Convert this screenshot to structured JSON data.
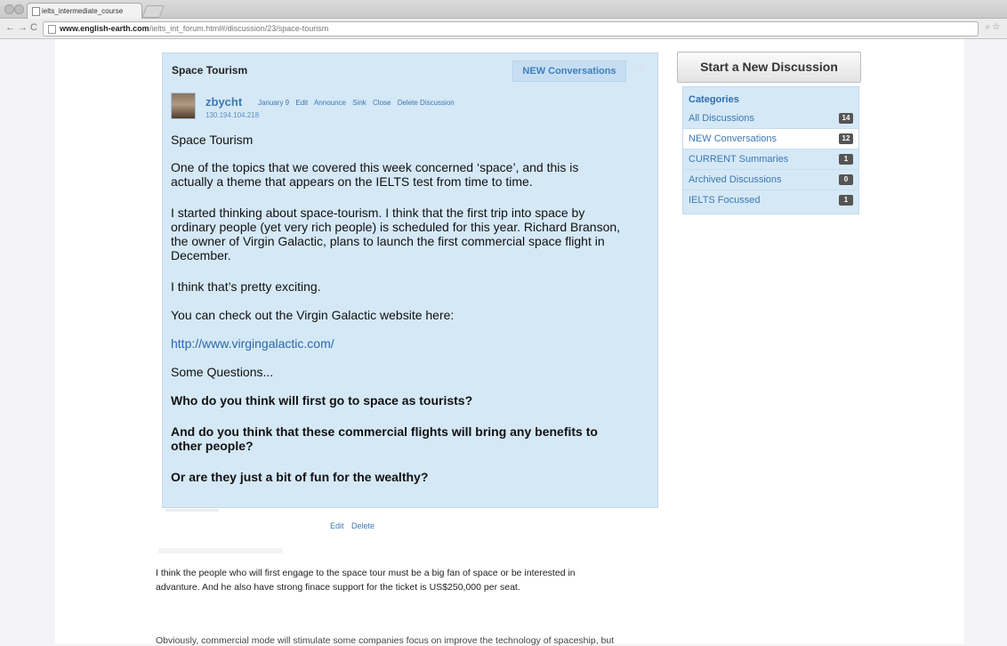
{
  "browser": {
    "tab_title": "ielts_intermediate_course ×",
    "url_domain": "www.english-earth.com",
    "url_path": "/ielts_int_forum.html#/discussion/23/space-tourism"
  },
  "post": {
    "title": "Space Tourism",
    "new_conversations_button": "NEW Conversations",
    "author": "zbycht",
    "date": "January 9",
    "actions": [
      "Edit",
      "Announce",
      "Sink",
      "Close",
      "Delete Discussion"
    ],
    "ip": "130.194.104.218",
    "body": {
      "heading": "Space Tourism",
      "para1_line1": "One of the topics that we covered this week concerned ‘space’, and this is",
      "para1_line2": "actually a theme that appears on the IELTS test from time to time.",
      "para2_line1": "I started thinking about space-tourism. I think that the first trip into space by",
      "para2_line2": "ordinary people (yet very rich people) is scheduled for this year. Richard Branson,",
      "para2_line3": "the owner of Virgin Galactic, plans to launch the first commercial space flight in",
      "para2_line4": "December.",
      "para3": "I think that’s pretty exciting.",
      "para4": "You can check out the Virgin Galactic website here:",
      "link": "http://www.virgingalactic.com/",
      "questions_intro": "Some Questions...",
      "q1": "Who do you think will first go to space as tourists?",
      "q2_line1": "And do you think that these commercial flights will bring any benefits to",
      "q2_line2": "other people?",
      "q3": "Or are they just a bit of fun for the wealthy?"
    },
    "edit_link": "Edit",
    "delete_link": "Delete"
  },
  "reply1": {
    "line1": "I think the people who will first engage to the space tour must be a big fan of space or be interested in",
    "line2": "advanture. And he also have strong finace support for the ticket is US$250,000 per seat."
  },
  "reply2": {
    "line1": "Obviously, commercial mode will stimulate some companies focus on improve the technology of spaceship, but"
  },
  "sidebar": {
    "start_button": "Start a New Discussion",
    "categories_title": "Categories",
    "categories": [
      {
        "label": "All Discussions",
        "count": "14"
      },
      {
        "label": "NEW Conversations",
        "count": "12"
      },
      {
        "label": "CURRENT Summaries",
        "count": "1"
      },
      {
        "label": "Archived Discussions",
        "count": "0"
      },
      {
        "label": "IELTS Focussed",
        "count": "1"
      }
    ]
  }
}
